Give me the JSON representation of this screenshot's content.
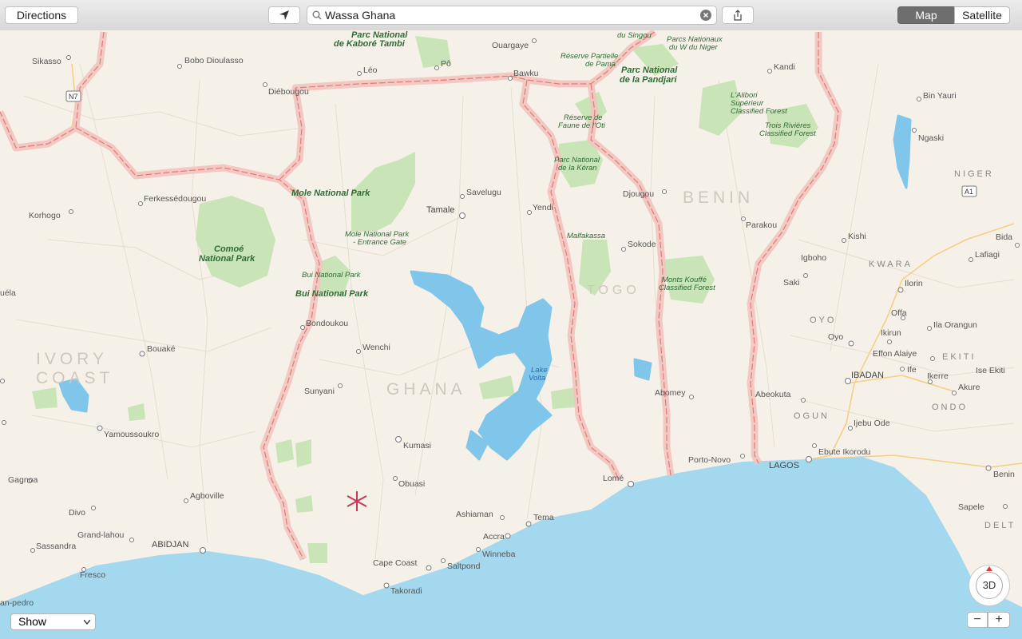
{
  "toolbar": {
    "directions_label": "Directions",
    "search_value": "Wassa Ghana",
    "map_label": "Map",
    "satellite_label": "Satellite"
  },
  "map": {
    "countries": [
      "GHANA",
      "BENIN",
      "TOGO",
      "IVORY",
      "COAST"
    ],
    "cities": [
      "Sikasso",
      "Bobo Dioulasso",
      "Diébougou",
      "Léo",
      "Pô",
      "Ouargaye",
      "Bawku",
      "du Singou",
      "Kandi",
      "Bin Yauri",
      "Ngaski",
      "Korhogo",
      "Ferkessédougou",
      "Tamale",
      "Savelugu",
      "Yendi",
      "Djougou",
      "Parakou",
      "Kishi",
      "Igboho",
      "Saki",
      "Ilorin",
      "Lafiagi",
      "Bida",
      "Offa",
      "Oyo",
      "Ikirun",
      "Ila Orangun",
      "Effon Alaiye",
      "Ife",
      "Ikerre",
      "Ise Ekiti",
      "Akure",
      "IBADAN",
      "Abeokuta",
      "Ijebu Ode",
      "Ebute Ikorodu",
      "LAGOS",
      "Porto-Novo",
      "Benin",
      "Sapele",
      "Abomey",
      "Sokode",
      "Lomé",
      "Tema",
      "Accra",
      "Winneba",
      "Ashiaman",
      "Saltpond",
      "Cape Coast",
      "Takoradi",
      "Obuasi",
      "Kumasi",
      "Sunyani",
      "Wenchi",
      "Bondoukou",
      "Bouaké",
      "Yamoussoukro",
      "Gagnoa",
      "Divo",
      "Agboville",
      "Grand-lahou",
      "Sassandra",
      "ABIDJAN",
      "Fresco",
      "an-pedro",
      "uéla"
    ],
    "parks": {
      "kabore": [
        "Parc National",
        "de Kaboré Tambi"
      ],
      "mole": "Mole National Park",
      "mole_gate": [
        "Mole National Park",
        "- Entrance Gate"
      ],
      "comoe": [
        "Comoé",
        "National Park"
      ],
      "bui_small": "Bui National Park",
      "bui": "Bui National Park",
      "pama": [
        "Réserve Partielle",
        "de Pama"
      ],
      "w_niger": [
        "Parcs Nationaux",
        "du W du Niger"
      ],
      "pendjari": [
        "Parc National",
        "de la Pandjari"
      ],
      "alibori": [
        "L'Alibori",
        "Supérieur",
        "Classified Forest"
      ],
      "trois": [
        "Trois Rivières",
        "Classified Forest"
      ],
      "oti": [
        "Réserve de",
        "Faune de l'Oti"
      ],
      "keran": [
        "Parc National",
        "de la Kéran"
      ],
      "malfakassa": "Malfakassa",
      "kouffe": [
        "Monts Kouffé",
        "Classified Forest"
      ]
    },
    "regions": [
      "NIGER",
      "KWARA",
      "OYO",
      "EKITI",
      "OGUN",
      "ONDO",
      "DELT"
    ],
    "road_shields": [
      "N7",
      "A1"
    ],
    "lake": [
      "Lake",
      "Volta"
    ]
  },
  "bottom": {
    "show_label": "Show",
    "compass_label": "3D",
    "zoom_out": "−",
    "zoom_in": "+"
  }
}
